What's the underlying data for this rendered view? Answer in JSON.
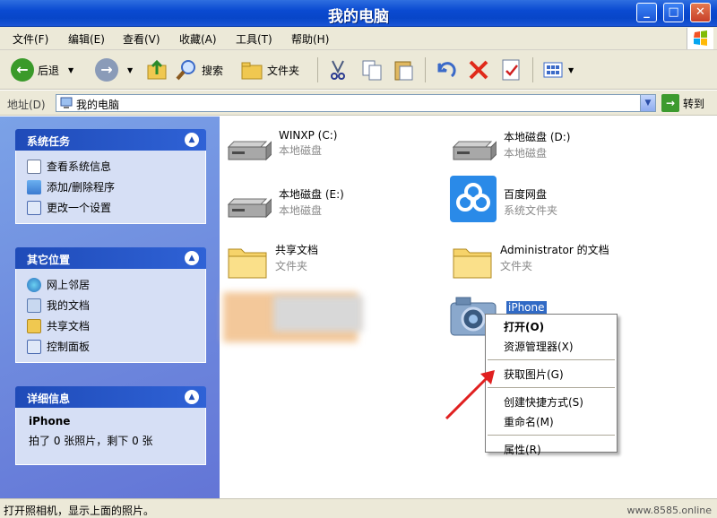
{
  "window": {
    "title": "我的电脑"
  },
  "menu": [
    "文件(F)",
    "编辑(E)",
    "查看(V)",
    "收藏(A)",
    "工具(T)",
    "帮助(H)"
  ],
  "toolbar": {
    "back": "后退",
    "search": "搜索",
    "folders": "文件夹"
  },
  "address": {
    "label": "地址(D)",
    "value": "我的电脑",
    "go": "转到"
  },
  "left_panels": {
    "system_tasks": {
      "title": "系统任务",
      "items": [
        "查看系统信息",
        "添加/删除程序",
        "更改一个设置"
      ]
    },
    "other_places": {
      "title": "其它位置",
      "items": [
        "网上邻居",
        "我的文档",
        "共享文档",
        "控制面板"
      ]
    },
    "details": {
      "title": "详细信息",
      "name": "iPhone",
      "desc": "拍了 0 张照片，剩下 0 张"
    }
  },
  "items": [
    {
      "name": "WINXP (C:)",
      "type": "本地磁盘"
    },
    {
      "name": "本地磁盘 (D:)",
      "type": "本地磁盘"
    },
    {
      "name": "本地磁盘 (E:)",
      "type": "本地磁盘"
    },
    {
      "name": "百度网盘",
      "type": "系统文件夹"
    },
    {
      "name": "共享文档",
      "type": "文件夹"
    },
    {
      "name": "Administrator 的文档",
      "type": "文件夹"
    },
    {
      "name": "iPhone",
      "type": ""
    }
  ],
  "context_menu": [
    "打开(O)",
    "资源管理器(X)",
    "获取图片(G)",
    "创建快捷方式(S)",
    "重命名(M)",
    "属性(R)"
  ],
  "status": "打开照相机，显示上面的照片。",
  "watermark": "www.8585.online"
}
